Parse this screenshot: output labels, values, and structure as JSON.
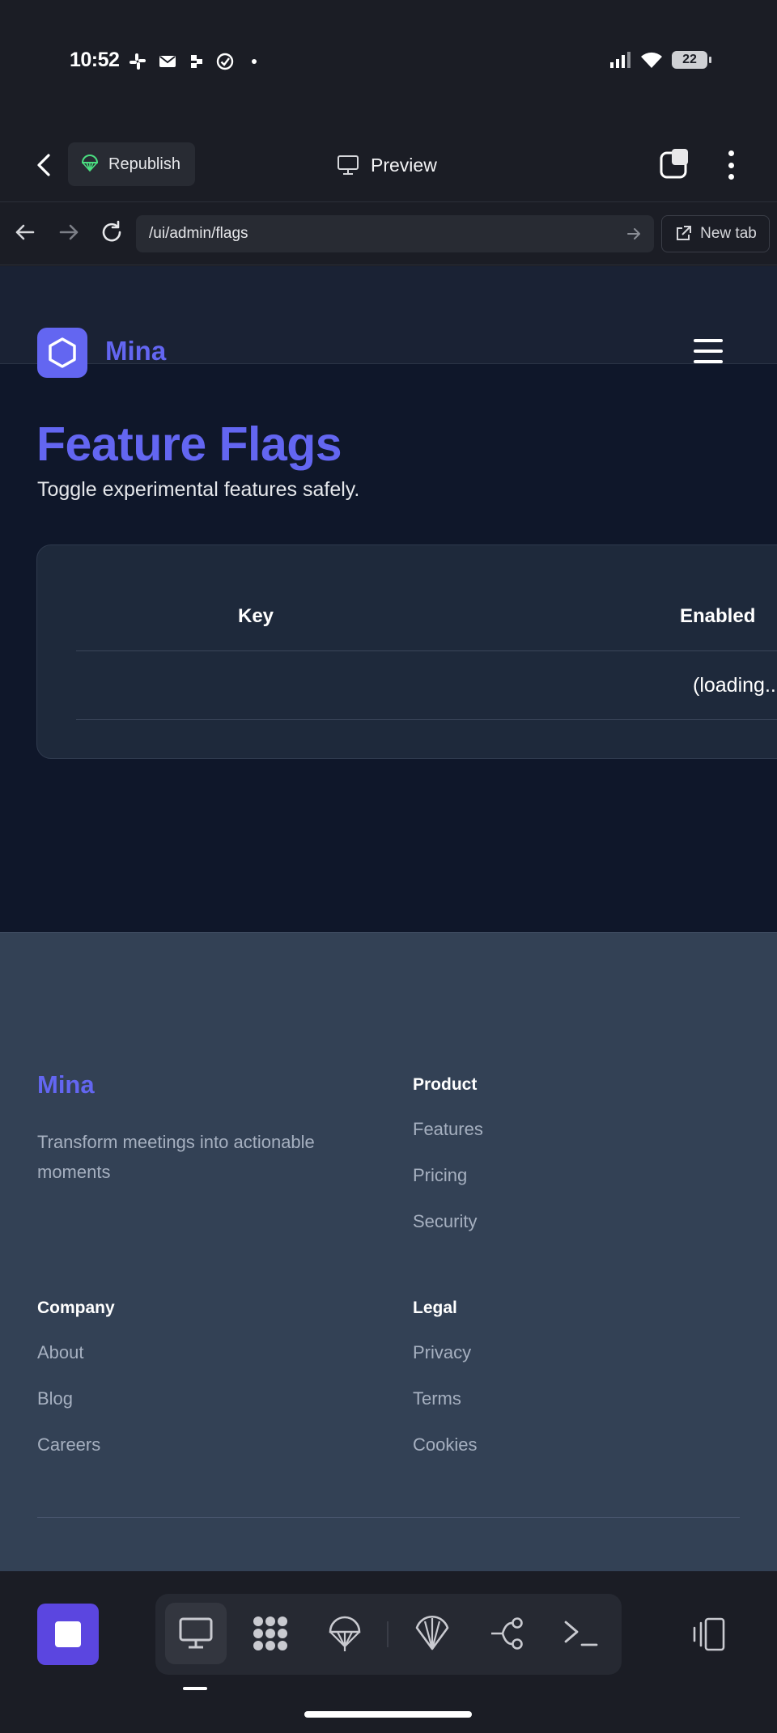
{
  "status_bar": {
    "time": "10:52",
    "battery": "22",
    "notification_icons": [
      "slack-icon",
      "mail-icon",
      "app-icon",
      "check-circle-icon",
      "dot-icon"
    ],
    "system_icons": [
      "signal-icon",
      "wifi-icon",
      "battery-icon"
    ]
  },
  "toolbar": {
    "republish_label": "Republish",
    "preview_label": "Preview"
  },
  "address_bar": {
    "url": "/ui/admin/flags",
    "new_tab_label": "New tab"
  },
  "site": {
    "brand": "Mina",
    "page_title": "Feature Flags",
    "page_subtitle": "Toggle experimental features safely.",
    "table": {
      "columns": [
        "Key",
        "Enabled"
      ],
      "rows": [
        {
          "enabled": "(loading..."
        }
      ]
    },
    "footer": {
      "brand": "Mina",
      "tagline": "Transform meetings into actionable moments",
      "columns": [
        {
          "heading": "Product",
          "links": [
            "Features",
            "Pricing",
            "Security"
          ]
        },
        {
          "heading": "Company",
          "links": [
            "About",
            "Blog",
            "Careers"
          ]
        },
        {
          "heading": "Legal",
          "links": [
            "Privacy",
            "Terms",
            "Cookies"
          ]
        }
      ]
    }
  },
  "dock": {
    "tools": [
      "preview-icon",
      "apps-icon",
      "deploy-icon",
      "shell-icon",
      "git-icon",
      "terminal-icon"
    ],
    "active_tool": "preview-icon"
  },
  "colors": {
    "accent": "#6366f1",
    "page_bg": "#0f172a",
    "card_bg": "#1e293b",
    "footer_bg": "#334155",
    "app_chrome": "#1b1d25",
    "stop_button": "#5b46e0"
  }
}
